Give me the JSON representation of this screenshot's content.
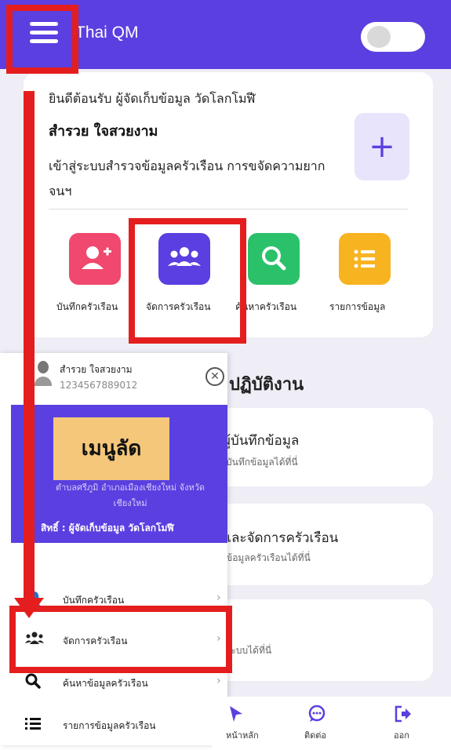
{
  "app": {
    "title": "Thai QM",
    "menu_icon": "hamburger-icon",
    "toggle_state": "off"
  },
  "welcome": {
    "line1": "ยินดีต้อนรับ ผู้จัดเก็บข้อมูล วัดโลกโมฬี",
    "name": "สำรวย ใจสวยงาม",
    "description": "เข้าสู่ระบบสำรวจข้อมูลครัวเรือน การขจัดความยากจนฯ",
    "add_symbol": "+"
  },
  "actions": [
    {
      "label": "บันทึกครัวเรือน",
      "icon": "add-user-icon",
      "color": "#f0486e"
    },
    {
      "label": "จัดการครัวเรือน",
      "icon": "group-icon",
      "color": "#5b3fe0"
    },
    {
      "label": "ค้นหาครัวเรือน",
      "icon": "search-icon",
      "color": "#2bc16b"
    },
    {
      "label": "รายการข้อมูล",
      "icon": "list-icon",
      "color": "#f7b320"
    }
  ],
  "section": {
    "title": "ปฏิบัติงาน"
  },
  "cards": [
    {
      "title": "ผู้บันทึกข้อมูล",
      "subtitle": "บันทึกข้อมูลได้ที่นี่"
    },
    {
      "title": "และจัดการครัวเรือน",
      "subtitle": "ข้อมูลครัวเรือนได้ที่นี่"
    },
    {
      "title": "",
      "subtitle": "ระบบได้ที่นี่"
    }
  ],
  "drawer": {
    "user_name": "สำรวย ใจสวยงาม",
    "user_id": "1234567889012",
    "close_icon": "close-circle-icon",
    "banner_overlay": "เมนูลัด",
    "address": "ตำบลศรีภูมิ อำเภอเมืองเชียงใหม่ จังหวัดเชียงใหม่",
    "role": "สิทธิ์ : ผู้จัดเก็บข้อมูล วัดโลกโมฬี",
    "items": [
      {
        "label": "บันทึกครัวเรือน",
        "icon": "add-user-icon"
      },
      {
        "label": "จัดการครัวเรือน",
        "icon": "group-icon"
      },
      {
        "label": "ค้นหาข้อมูลครัวเรือน",
        "icon": "search-icon"
      },
      {
        "label": "รายการข้อมูลครัวเรือน",
        "icon": "list-icon"
      }
    ]
  },
  "bottom_nav": [
    {
      "label": "หน้าหลัก",
      "icon": "home-icon"
    },
    {
      "label": "ติดต่อ",
      "icon": "chat-icon"
    },
    {
      "label": "ออก",
      "icon": "logout-icon"
    }
  ],
  "colors": {
    "primary": "#5b3fe0",
    "highlight": "#e41e1e",
    "banner_overlay": "#f4c77a"
  }
}
